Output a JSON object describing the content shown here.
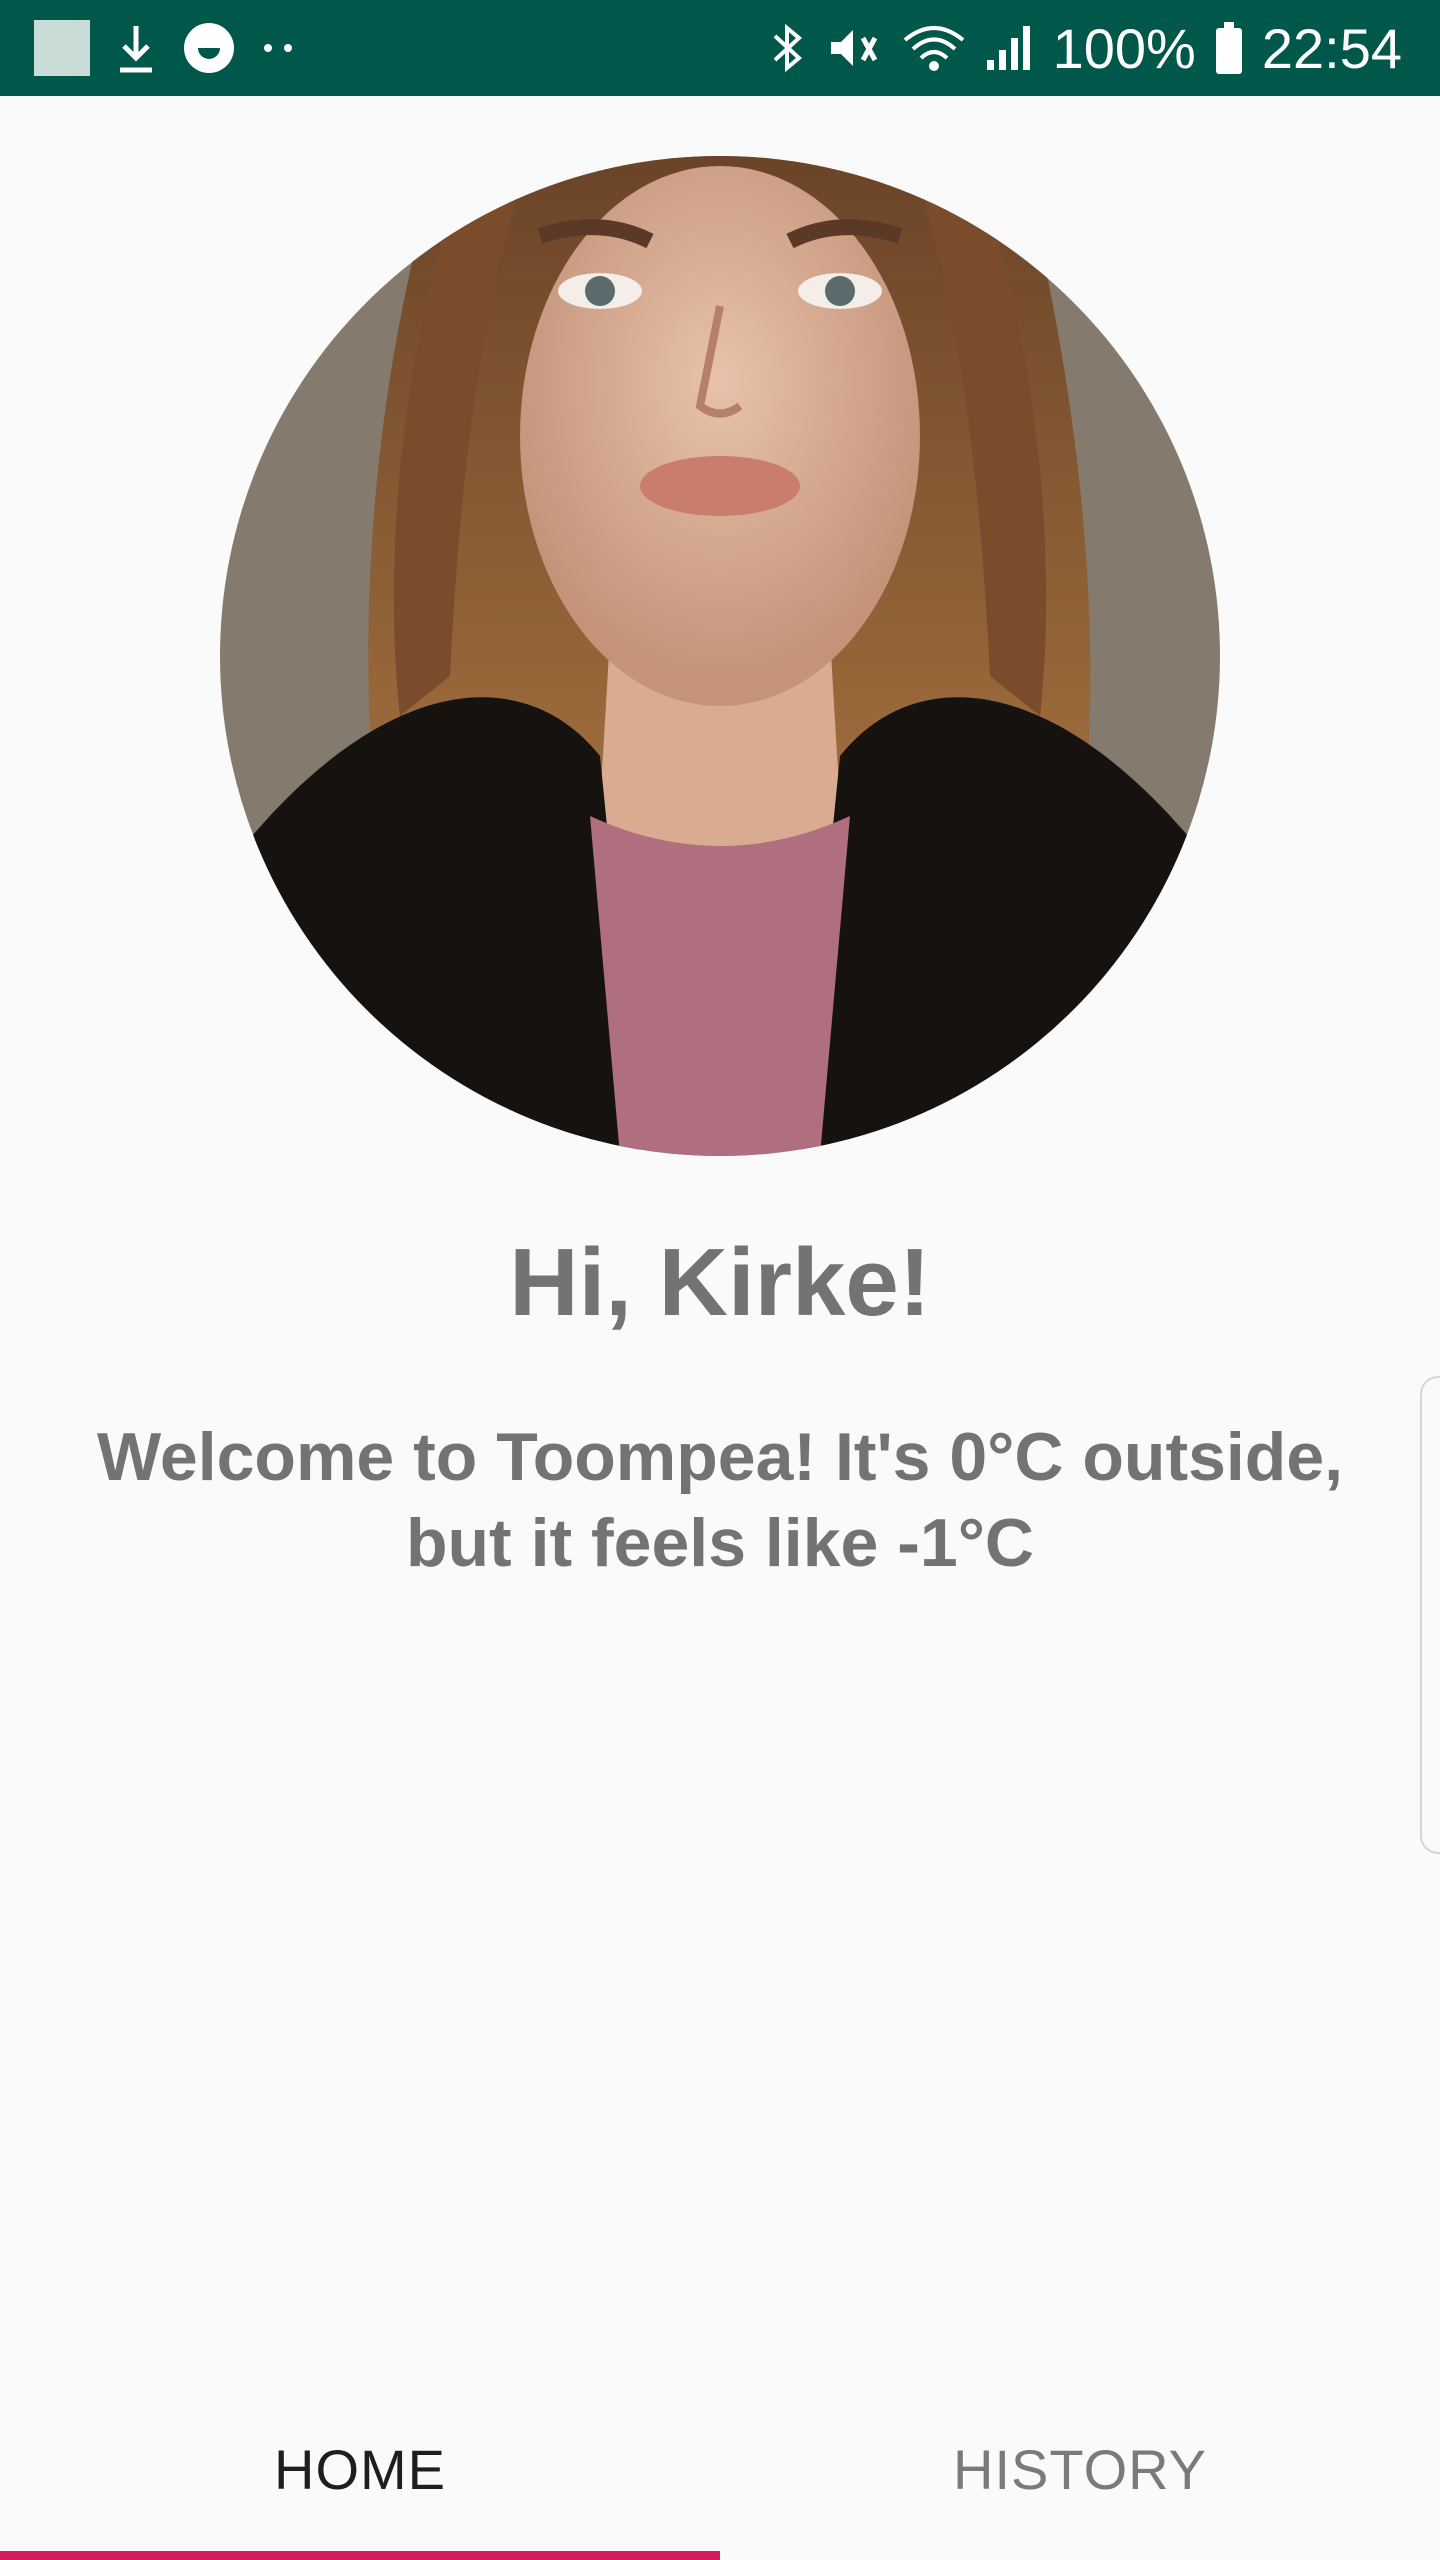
{
  "status_bar": {
    "battery": "100%",
    "time": "22:54",
    "icons": [
      "image-icon",
      "download-icon",
      "smiley-icon",
      "dots-icon",
      "bluetooth-icon",
      "vibrate-icon",
      "wifi-icon",
      "signal-icon",
      "battery-icon"
    ]
  },
  "profile": {
    "avatar_icon": "profile-photo",
    "greeting": "Hi, Kirke!",
    "welcome": "Welcome to Toompea! It's 0°C outside, but it feels like -1°C"
  },
  "tabs": [
    {
      "label": "HOME",
      "selected": true
    },
    {
      "label": "HISTORY",
      "selected": false
    }
  ],
  "colors": {
    "status_bar": "#00584a",
    "accent": "#d81b60",
    "text_gray": "#737373"
  }
}
